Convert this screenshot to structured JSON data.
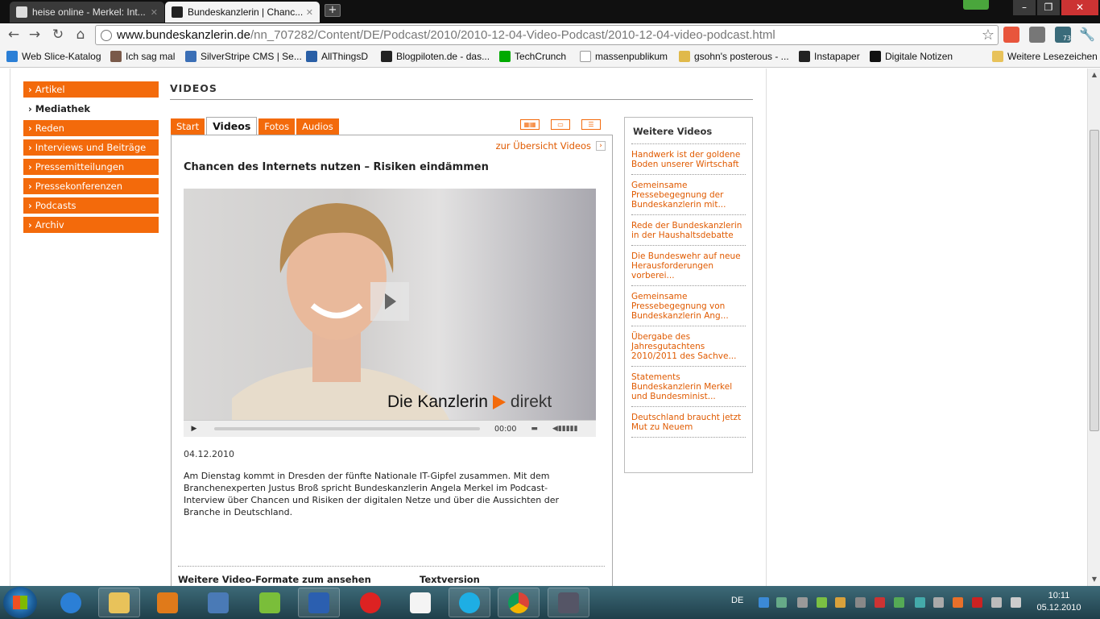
{
  "browser": {
    "tabs": [
      {
        "label": "heise online - Merkel: Int...",
        "favicon_color": "#555555"
      },
      {
        "label": "Bundeskanzlerin | Chanc...",
        "favicon_color": "#222222"
      }
    ],
    "url_domain": "www.bundeskanzlerin.de",
    "url_path": "/nn_707282/Content/DE/Podcast/2010/2010-12-04-Video-Podcast/2010-12-04-video-podcast.html",
    "extension_badge": "73",
    "bookmarks": [
      "Web Slice-Katalog",
      "Ich sag mal",
      "SilverStripe CMS | Se...",
      "AllThingsD",
      "Blogpiloten.de - das...",
      "TechCrunch",
      "massenpublikum",
      "gsohn's posterous - ...",
      "Instapaper",
      "Digitale Notizen"
    ],
    "other_bookmarks": "Weitere Lesezeichen"
  },
  "page": {
    "nav": [
      {
        "label": "Artikel",
        "active": false
      },
      {
        "label": "Mediathek",
        "active": true
      },
      {
        "label": "Reden",
        "active": false
      },
      {
        "label": "Interviews und Beiträge",
        "active": false
      },
      {
        "label": "Pressemitteilungen",
        "active": false
      },
      {
        "label": "Pressekonferenzen",
        "active": false
      },
      {
        "label": "Podcasts",
        "active": false
      },
      {
        "label": "Archiv",
        "active": false
      }
    ],
    "section_title": "VIDEOS",
    "tabs": [
      "Start",
      "Videos",
      "Fotos",
      "Audios"
    ],
    "active_tab": "Videos",
    "overview_link": "zur Übersicht Videos",
    "video": {
      "title": "Chancen des Internets nutzen – Risiken eindämmen",
      "brand_text_1": "Die Kanzlerin",
      "brand_text_2": "direkt",
      "timecode": "00:00",
      "date": "04.12.2010",
      "description": "Am Dienstag kommt in Dresden der fünfte Nationale IT-Gipfel zusammen. Mit dem Branchenexperten Justus Broß spricht Bundeskanzlerin Angela Merkel im Podcast-Interview über Chancen und Risiken der digitalen Netze und über die Aussichten der Branche in Deutschland."
    },
    "more_formats": "Weitere Video-Formate zum ansehen",
    "text_version": "Textversion",
    "sidebar": {
      "title": "Weitere Videos",
      "items": [
        "Handwerk ist der goldene Boden unserer Wirtschaft",
        "Gemeinsame Pressebegegnung der Bundeskanzlerin mit...",
        "Rede der Bundeskanzlerin in der Haushaltsdebatte",
        "Die Bundeswehr auf neue Herausforderungen vorberei...",
        "Gemeinsame Pressebegegnung von Bundeskanzlerin Ang...",
        "Übergabe des Jahresgutachtens 2010/2011 des Sachve...",
        "Statements Bundeskanzlerin Merkel und Bundesminist...",
        "Deutschland braucht jetzt Mut zu Neuem"
      ]
    },
    "colors": {
      "accent": "#f36a0b",
      "link": "#e05a00"
    }
  },
  "taskbar": {
    "language": "DE",
    "time": "10:11",
    "date": "05.12.2010"
  }
}
